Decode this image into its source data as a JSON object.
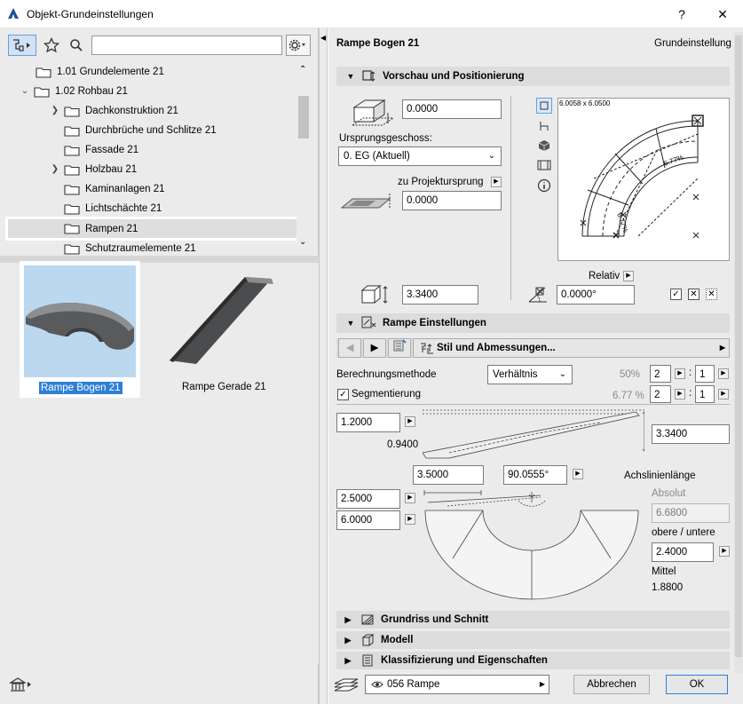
{
  "window": {
    "title": "Objekt-Grundeinstellungen",
    "help_label": "?",
    "close_label": "✕"
  },
  "library": {
    "search_placeholder": "",
    "tree": [
      {
        "label": "1.01 Grundelemente 21",
        "level": 0,
        "expander": ""
      },
      {
        "label": "1.02 Rohbau 21",
        "level": 0,
        "expander": "v"
      },
      {
        "label": "Dachkonstruktion 21",
        "level": 1,
        "expander": ">"
      },
      {
        "label": "Durchbrüche und Schlitze 21",
        "level": 1,
        "expander": ""
      },
      {
        "label": "Fassade 21",
        "level": 1,
        "expander": ""
      },
      {
        "label": "Holzbau 21",
        "level": 1,
        "expander": ">"
      },
      {
        "label": "Kaminanlagen 21",
        "level": 1,
        "expander": ""
      },
      {
        "label": "Lichtschächte 21",
        "level": 1,
        "expander": ""
      },
      {
        "label": "Rampen 21",
        "level": 1,
        "expander": "",
        "selected": true
      },
      {
        "label": "Schutzraumelemente 21",
        "level": 1,
        "expander": ""
      }
    ],
    "items": [
      {
        "label": "Rampe Bogen 21",
        "selected": true
      },
      {
        "label": "Rampe Gerade 21",
        "selected": false
      }
    ]
  },
  "header": {
    "object_name": "Rampe Bogen 21",
    "mode": "Grundeinstellung"
  },
  "preview_section": {
    "title": "Vorschau und Positionierung",
    "elevation_value": "0.0000",
    "story_label": "Ursprungsgeschoss:",
    "story_value": "0. EG (Aktuell)",
    "project_origin_label": "zu Projektursprung",
    "project_origin_value": "0.0000",
    "preview_size": "6.0058 x 6.0500",
    "preview_slope_a": "6.77%",
    "preview_slope_b": "6.77%",
    "relative_label": "Relativ",
    "height_value": "3.3400",
    "angle_value": "0.0000°"
  },
  "ramp_section": {
    "title": "Rampe Einstellungen",
    "nav_page_label": "Stil und Abmessungen...",
    "calc_method_label": "Berechnungsmethode",
    "calc_method_value": "Verhältnis",
    "calc_percent": "50%",
    "calc_ratio_a": "2",
    "calc_ratio_b": "1",
    "segment_label": "Segmentierung",
    "segment_checked": true,
    "segment_percent": "6.77 %",
    "segment_ratio_a": "2",
    "segment_ratio_b": "1",
    "ratio_separator": ":",
    "thickness_value": "1.2000",
    "thickness_label": "0.9400",
    "total_height_value": "3.3400",
    "radius_value": "3.5000",
    "arc_angle_value": "90.0555°",
    "axis_length_label": "Achslinienlänge",
    "absolute_label": "Absolut",
    "absolute_value": "6.6800",
    "inner_width_value": "2.5000",
    "outer_width_value": "6.0000",
    "upper_lower_label": "obere / untere",
    "upper_lower_value": "2.4000",
    "middle_label": "Mittel",
    "middle_value": "1.8800"
  },
  "collapsed_sections": [
    {
      "title": "Grundriss und Schnitt"
    },
    {
      "title": "Modell"
    },
    {
      "title": "Klassifizierung und Eigenschaften"
    }
  ],
  "footer": {
    "layer_value": "056 Rampe",
    "cancel_label": "Abbrechen",
    "ok_label": "OK"
  }
}
